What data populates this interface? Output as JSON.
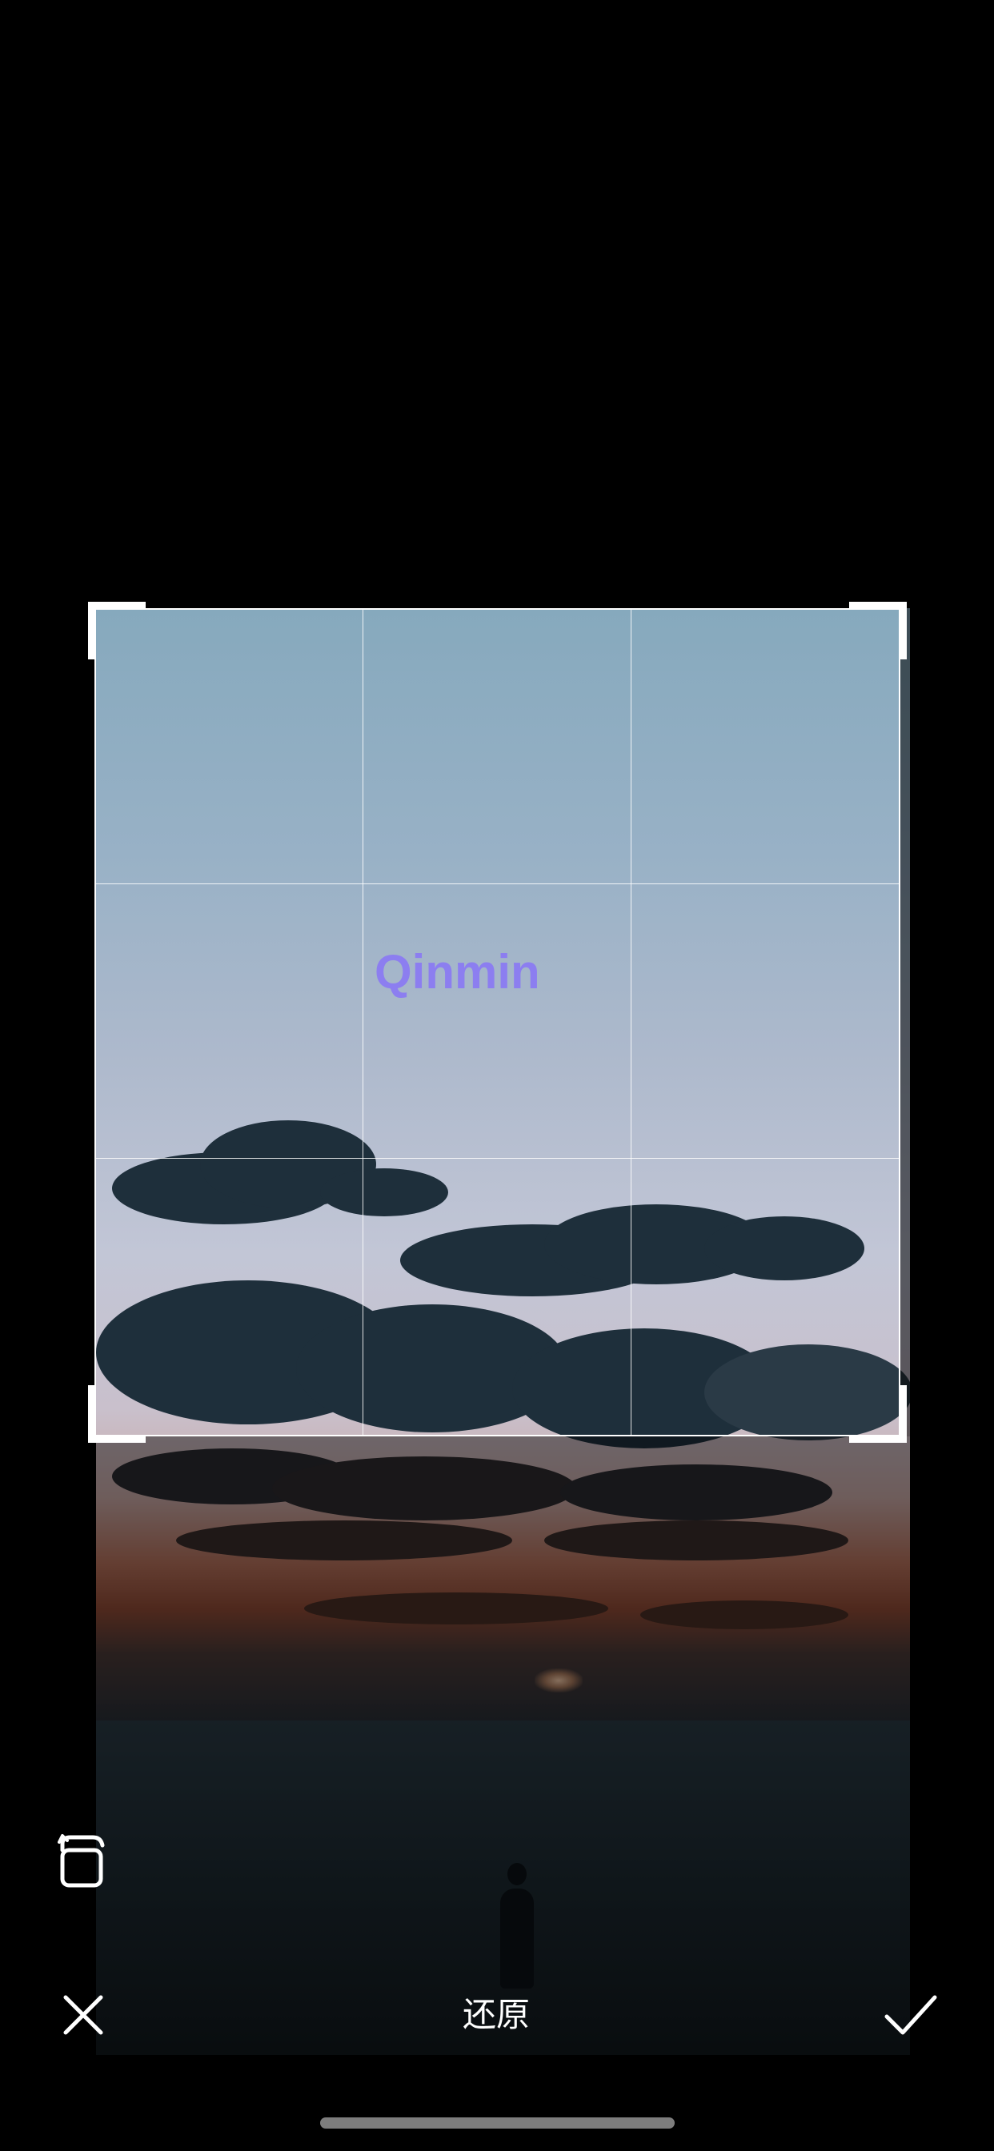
{
  "watermark": {
    "text": "Qinmin",
    "color": "#8c7ef0"
  },
  "toolbar": {
    "reset_label": "还原",
    "cancel_icon": "close-icon",
    "confirm_icon": "checkmark-icon",
    "rotate_icon": "rotate-icon"
  },
  "crop": {
    "grid": "3x3"
  }
}
